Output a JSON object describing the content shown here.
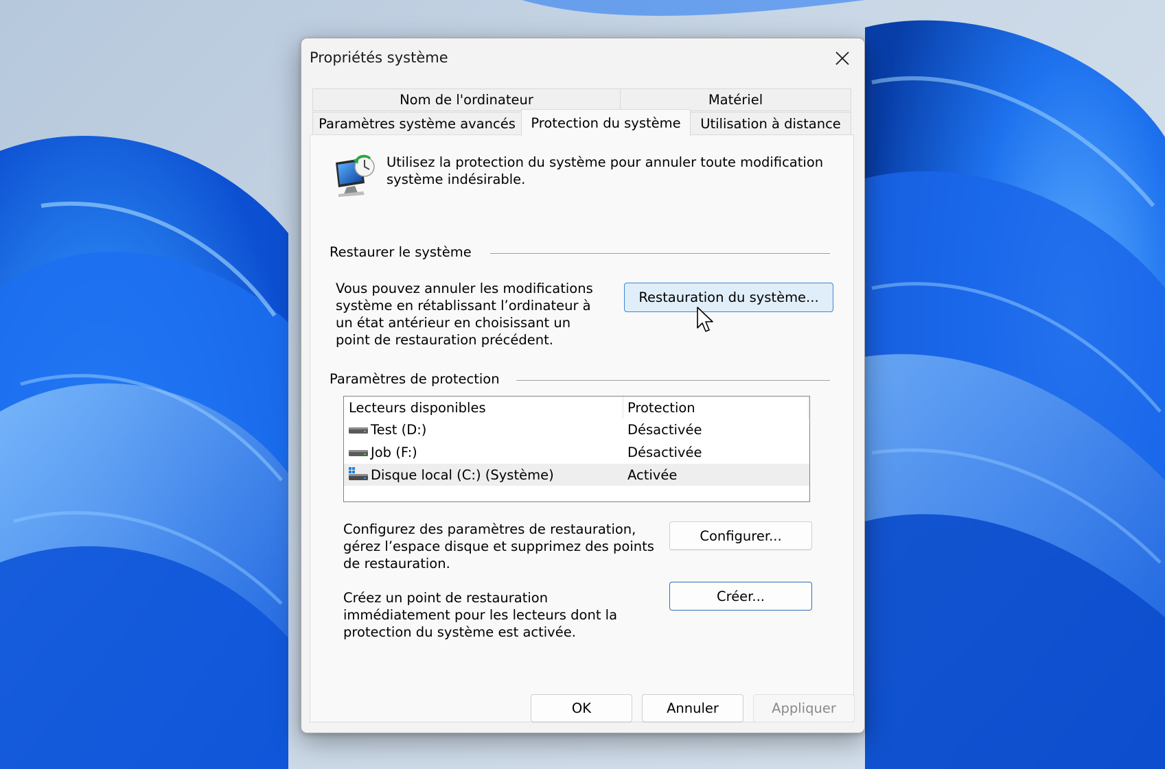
{
  "dialog": {
    "title": "Propriétés système"
  },
  "tabs": {
    "row1": [
      {
        "label": "Nom de l'ordinateur"
      },
      {
        "label": "Matériel"
      }
    ],
    "row2": [
      {
        "label": "Paramètres système avancés"
      },
      {
        "label": "Protection du système",
        "active": true
      },
      {
        "label": "Utilisation à distance"
      }
    ]
  },
  "intro": {
    "icon": "system-protection-icon",
    "text": "Utilisez la protection du système pour annuler toute modification système indésirable."
  },
  "restore_group": {
    "header": "Restaurer le système",
    "description": "Vous pouvez annuler les modifications système en rétablissant l’ordinateur à un état antérieur en choisissant un point de restauration précédent.",
    "button_label": "Restauration du système..."
  },
  "protection_group": {
    "header": "Paramètres de protection",
    "columns": [
      "Lecteurs disponibles",
      "Protection"
    ],
    "drives": [
      {
        "name": "Test (D:)",
        "protection": "Désactivée",
        "icon": "drive-icon"
      },
      {
        "name": "Job (F:)",
        "protection": "Désactivée",
        "icon": "drive-icon"
      },
      {
        "name": "Disque local (C:) (Système)",
        "protection": "Activée",
        "icon": "system-drive-icon",
        "selected": true
      }
    ],
    "configure_text": "Configurez des paramètres de restauration, gérez l’espace disque et supprimez des points de restauration.",
    "configure_button": "Configurer...",
    "create_text": "Créez un point de restauration immédiatement pour les lecteurs dont la protection du système est activée.",
    "create_button": "Créer..."
  },
  "footer": {
    "ok": "OK",
    "cancel": "Annuler",
    "apply": "Appliquer"
  },
  "colors": {
    "accent": "#0067c0",
    "wallpaper_blue": "#1a6cf0"
  }
}
